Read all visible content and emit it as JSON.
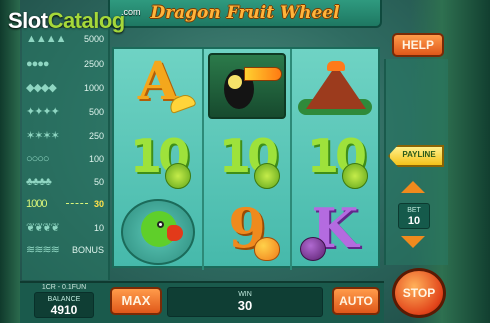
{
  "logo": {
    "brand_main": "Slot",
    "brand_accent": "Catalog",
    "domain_suffix": ".com"
  },
  "game": {
    "title": "Dragon Fruit Wheel"
  },
  "paytable": {
    "rows": [
      {
        "icon": "tropical-leaf-icon",
        "glyph": "▲▲▲▲",
        "value": "5000"
      },
      {
        "icon": "lime-slice-icon",
        "glyph": "●●●●",
        "value": "2500"
      },
      {
        "icon": "feather-icon",
        "glyph": "◆◆◆◆",
        "value": "1000"
      },
      {
        "icon": "fern-icon",
        "glyph": "✦✦✦✦",
        "value": "500"
      },
      {
        "icon": "vine-icon",
        "glyph": "✶✶✶✶",
        "value": "250"
      },
      {
        "icon": "ring-icon",
        "glyph": "○○○○",
        "value": "100"
      },
      {
        "icon": "berry-icon",
        "glyph": "♣♣♣♣",
        "value": "50"
      },
      {
        "icon": "number-glyph-icon",
        "glyph": "1000",
        "value": "30",
        "active": true
      },
      {
        "icon": "leaf-pair-icon",
        "glyph": "❦❦❦❦",
        "value": "10"
      },
      {
        "icon": "bonus-symbol-icon",
        "glyph": "≋≋≋≋",
        "value": "BONUS"
      }
    ]
  },
  "reels": [
    [
      {
        "symbol": "A",
        "fruit": "banana"
      },
      {
        "symbol": "10",
        "fruit": "starfruit"
      },
      {
        "symbol": "parrot"
      }
    ],
    [
      {
        "symbol": "toucan"
      },
      {
        "symbol": "10",
        "fruit": "starfruit"
      },
      {
        "symbol": "9",
        "fruit": "mango"
      }
    ],
    [
      {
        "symbol": "volcano"
      },
      {
        "symbol": "10",
        "fruit": "starfruit"
      },
      {
        "symbol": "K",
        "fruit": "mangosteen"
      }
    ]
  ],
  "controls": {
    "help_label": "HELP",
    "payline_label": "PAYLINE",
    "bet_label": "BET",
    "bet_value": "10",
    "max_label": "MAX",
    "auto_label": "AUTO",
    "stop_label": "STOP"
  },
  "status": {
    "cr_info": "1CR - 0.1FUN",
    "balance_label": "BALANCE",
    "balance_value": "4910",
    "win_label": "WIN",
    "win_value": "30"
  },
  "colors": {
    "accent_orange": "#e0581a",
    "title_gold": "#ffb43a",
    "reel_teal": "#6fd3c4",
    "brand_green": "#a5d83a"
  }
}
